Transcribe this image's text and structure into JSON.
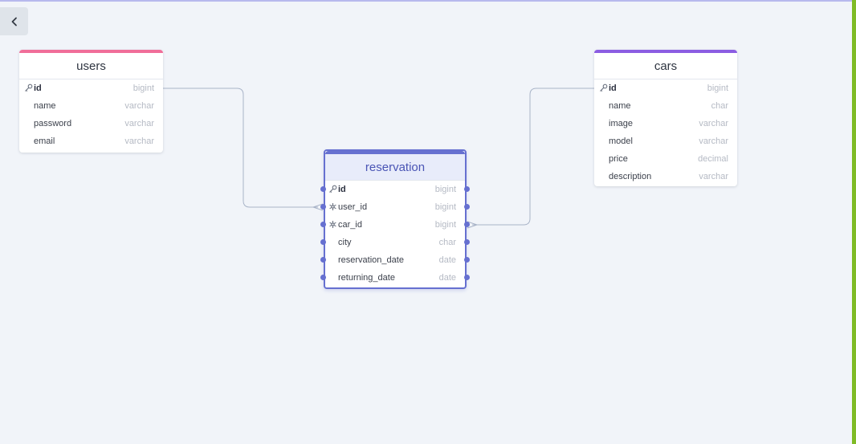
{
  "colors": {
    "users_accent": "#f06e99",
    "cars_accent": "#8b5de2",
    "reservation_accent": "#6670d0",
    "link": "#a9b4c8",
    "right_bar": "#7fbb26"
  },
  "back_button": {
    "icon": "chevron-left-icon"
  },
  "tables": {
    "users": {
      "title": "users",
      "fields": [
        {
          "name": "id",
          "type": "bigint",
          "key": "primary"
        },
        {
          "name": "name",
          "type": "varchar"
        },
        {
          "name": "password",
          "type": "varchar"
        },
        {
          "name": "email",
          "type": "varchar"
        }
      ]
    },
    "reservation": {
      "title": "reservation",
      "fields": [
        {
          "name": "id",
          "type": "bigint",
          "key": "primary"
        },
        {
          "name": "user_id",
          "type": "bigint",
          "key": "foreign"
        },
        {
          "name": "car_id",
          "type": "bigint",
          "key": "foreign"
        },
        {
          "name": "city",
          "type": "char"
        },
        {
          "name": "reservation_date",
          "type": "date"
        },
        {
          "name": "returning_date",
          "type": "date"
        }
      ]
    },
    "cars": {
      "title": "cars",
      "fields": [
        {
          "name": "id",
          "type": "bigint",
          "key": "primary"
        },
        {
          "name": "name",
          "type": "char"
        },
        {
          "name": "image",
          "type": "varchar"
        },
        {
          "name": "model",
          "type": "varchar"
        },
        {
          "name": "price",
          "type": "decimal"
        },
        {
          "name": "description",
          "type": "varchar"
        }
      ]
    }
  },
  "relationships": [
    {
      "from": "users.id",
      "to": "reservation.user_id",
      "type": "one-to-many"
    },
    {
      "from": "cars.id",
      "to": "reservation.car_id",
      "type": "one-to-many"
    }
  ]
}
